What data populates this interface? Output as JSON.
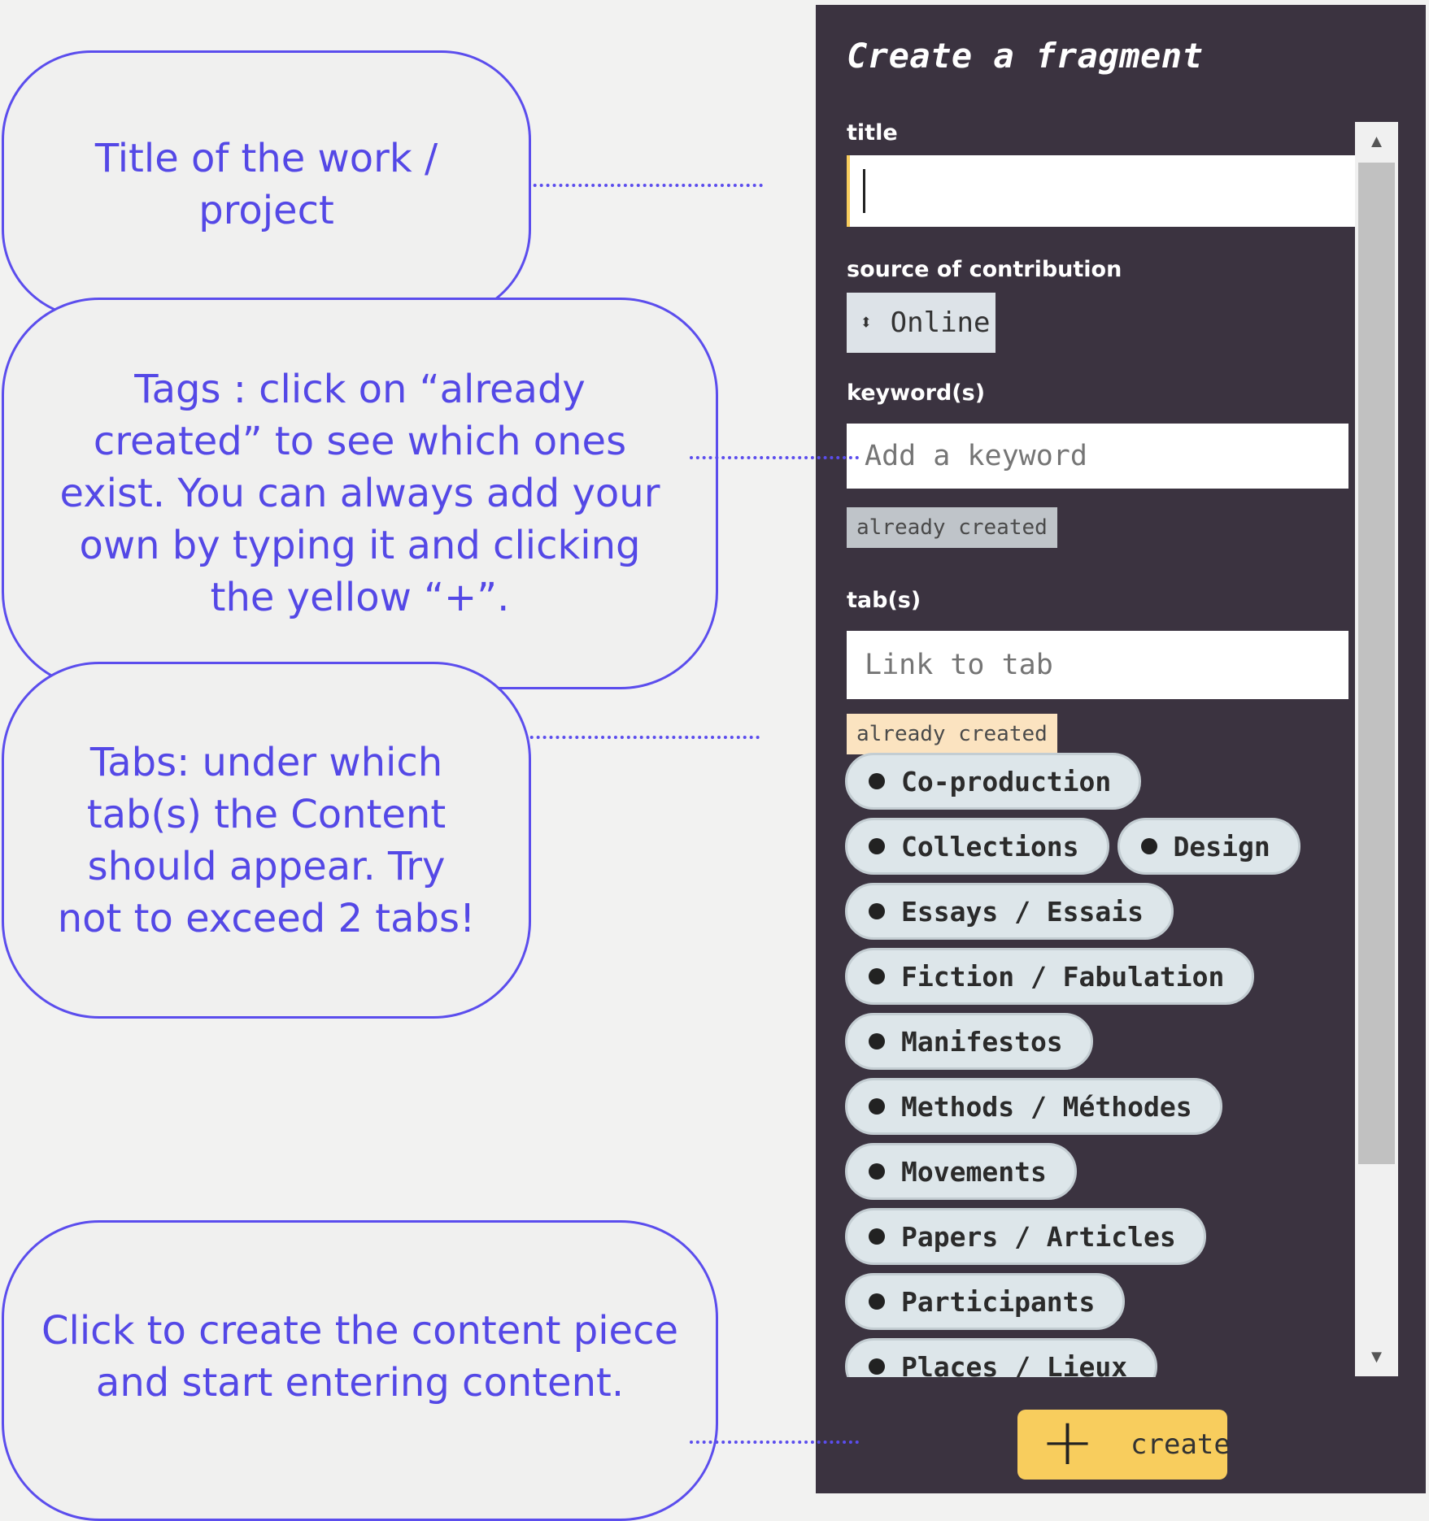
{
  "callouts": {
    "title": "Title of the work / project",
    "tags": "Tags : click on “already created” to see which ones exist. You can always add your own by typing it and clicking the yellow “+”.",
    "tabs": "Tabs: under which tab(s) the Content should appear. Try not to exceed 2 tabs!",
    "create": "Click to create the content piece and start entering content."
  },
  "panel": {
    "heading": "Create a fragment",
    "title_label": "title",
    "title_value": "",
    "source_label": "source of contribution",
    "source_value": "Online",
    "keyword_label": "keyword(s)",
    "keyword_placeholder": "Add a keyword",
    "keyword_already": "already created",
    "tab_label": "tab(s)",
    "tab_placeholder": "Link to tab",
    "tab_already": "already created",
    "tabs": [
      "Co-production",
      "Collections",
      "Design",
      "Essays / Essais",
      "Fiction / Fabulation",
      "Manifestos",
      "Methods / Méthodes",
      "Movements",
      "Papers / Articles",
      "Participants",
      "Places / Lieux"
    ],
    "create_label": "create"
  },
  "colors": {
    "accent": "#5b4ded",
    "panel_bg": "#3b3340",
    "create_button": "#f8cd5d",
    "title_focus": "#f8cd5d",
    "already_active": "#fbe3c0",
    "already_inactive": "#bfc4c9",
    "chip_bg": "#dde6ea"
  },
  "icons": {
    "select": "up-down-chevron-icon",
    "create": "plus-icon",
    "scroll_up": "triangle-up-icon",
    "scroll_down": "triangle-down-icon"
  }
}
